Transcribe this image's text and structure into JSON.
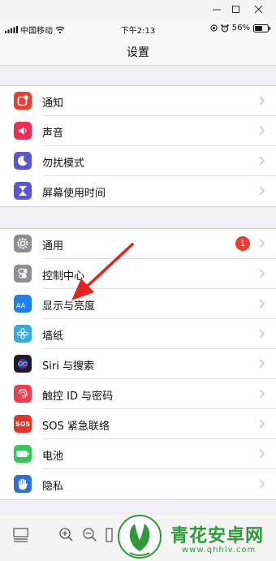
{
  "status": {
    "carrier": "中国移动",
    "time": "下午2:13",
    "battery": "56%"
  },
  "nav": {
    "title": "设置"
  },
  "group1": [
    {
      "label": "通知",
      "icon": "notification-icon",
      "color": "#f23b30"
    },
    {
      "label": "声音",
      "icon": "speaker-icon",
      "color": "#f22d55"
    },
    {
      "label": "勿扰模式",
      "icon": "moon-icon",
      "color": "#5856d6"
    },
    {
      "label": "屏幕使用时间",
      "icon": "hourglass-icon",
      "color": "#5856d6"
    }
  ],
  "group2": [
    {
      "label": "通用",
      "icon": "gear-icon",
      "color": "#8e8e93",
      "badge": "1"
    },
    {
      "label": "控制中心",
      "icon": "toggles-icon",
      "color": "#8e8e93"
    },
    {
      "label": "显示与亮度",
      "icon": "text-size-icon",
      "color": "#1f7ff0",
      "icon_text": "AA"
    },
    {
      "label": "墙纸",
      "icon": "flower-icon",
      "color": "#33aadc"
    },
    {
      "label": "Siri 与搜索",
      "icon": "siri-icon",
      "color": "#1c1c2e"
    },
    {
      "label": "触控 ID 与密码",
      "icon": "fingerprint-icon",
      "color": "#f23b4b"
    },
    {
      "label": "SOS 紧急联络",
      "icon": "sos-icon",
      "color": "#e63327",
      "icon_text": "SOS"
    },
    {
      "label": "电池",
      "icon": "battery-icon",
      "color": "#34c759"
    },
    {
      "label": "隐私",
      "icon": "hand-icon",
      "color": "#2f6fe0"
    }
  ],
  "watermark": {
    "title": "青花安卓网",
    "url": "www.qhhlv.com"
  },
  "colors": {
    "arrow": "#e5221c",
    "accent_green": "#2e9a3a"
  }
}
